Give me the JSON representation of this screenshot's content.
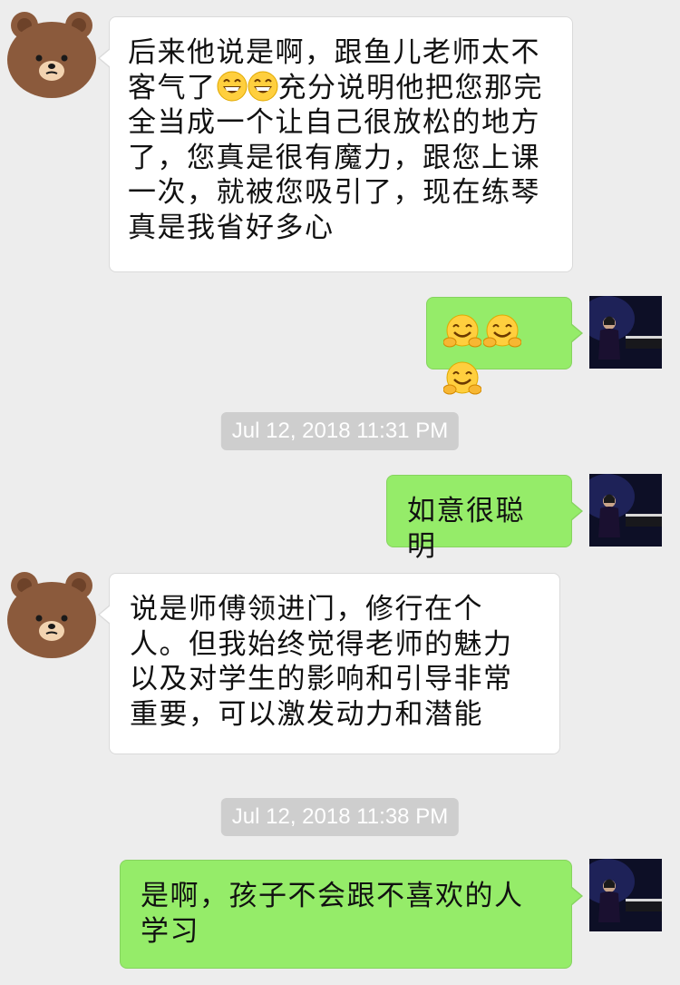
{
  "messages": [
    {
      "sender": "contact",
      "text_before_emoji": "后来他说是啊，跟鱼儿老师太不客气了",
      "emojis": [
        "grinning-squint-emoji",
        "grinning-squint-emoji"
      ],
      "text_after_emoji": "充分说明他把您那完全当成一个让自己很放松的地方了，您真是很有魔力，跟您上课一次，就被您吸引了，现在练琴真是我省好多心"
    },
    {
      "sender": "me",
      "emojis": [
        "hugging-face-emoji",
        "hugging-face-emoji",
        "hugging-face-emoji"
      ]
    },
    {
      "type": "timestamp",
      "text": "Jul 12, 2018 11:31 PM"
    },
    {
      "sender": "me",
      "text": "如意很聪明"
    },
    {
      "sender": "contact",
      "text": "说是师傅领进门，修行在个人。但我始终觉得老师的魅力以及对学生的影响和引导非常重要，可以激发动力和潜能"
    },
    {
      "type": "timestamp",
      "text": "Jul 12, 2018 11:38 PM"
    },
    {
      "sender": "me",
      "text": "是啊，孩子不会跟不喜欢的人学习"
    }
  ],
  "colors": {
    "background": "#ededed",
    "my_bubble": "#95ec69",
    "contact_bubble": "#ffffff",
    "timestamp_bg": "#cecece"
  }
}
